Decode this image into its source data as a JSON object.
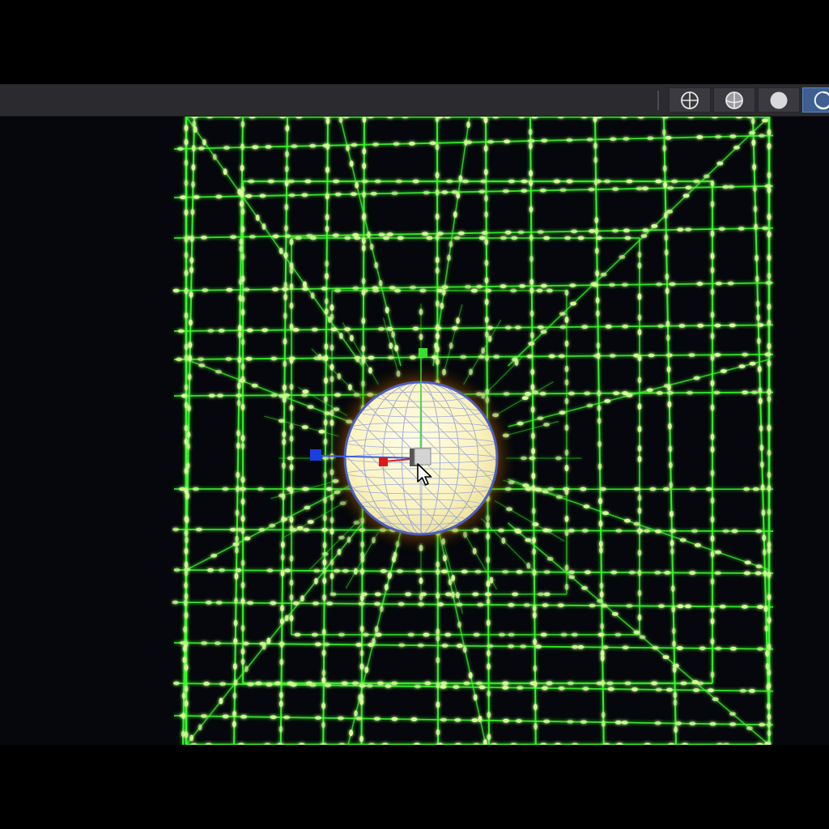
{
  "toolbar": {
    "shading_modes": [
      {
        "icon": "wireframe-sphere-icon",
        "active": false
      },
      {
        "icon": "shaded-wireframe-sphere-icon",
        "active": false
      },
      {
        "icon": "solid-sphere-icon",
        "active": false
      },
      {
        "icon": "material-preview-sphere-icon",
        "active": true
      }
    ]
  },
  "viewport": {
    "grid_color": "#39ff2a",
    "dot_color": "#d8ff9a",
    "background_color": "#05070c",
    "object": {
      "type": "uv-sphere",
      "fill_color": "#fbf7c8",
      "outline_color": "#4a5fc0",
      "glow_color": "#ffa81a"
    },
    "gizmo": {
      "x_axis_color": "#e01818",
      "y_axis_color": "#39e02a",
      "z_axis_color": "#1a3fe0"
    },
    "cursor": "arrow-cursor-icon"
  }
}
